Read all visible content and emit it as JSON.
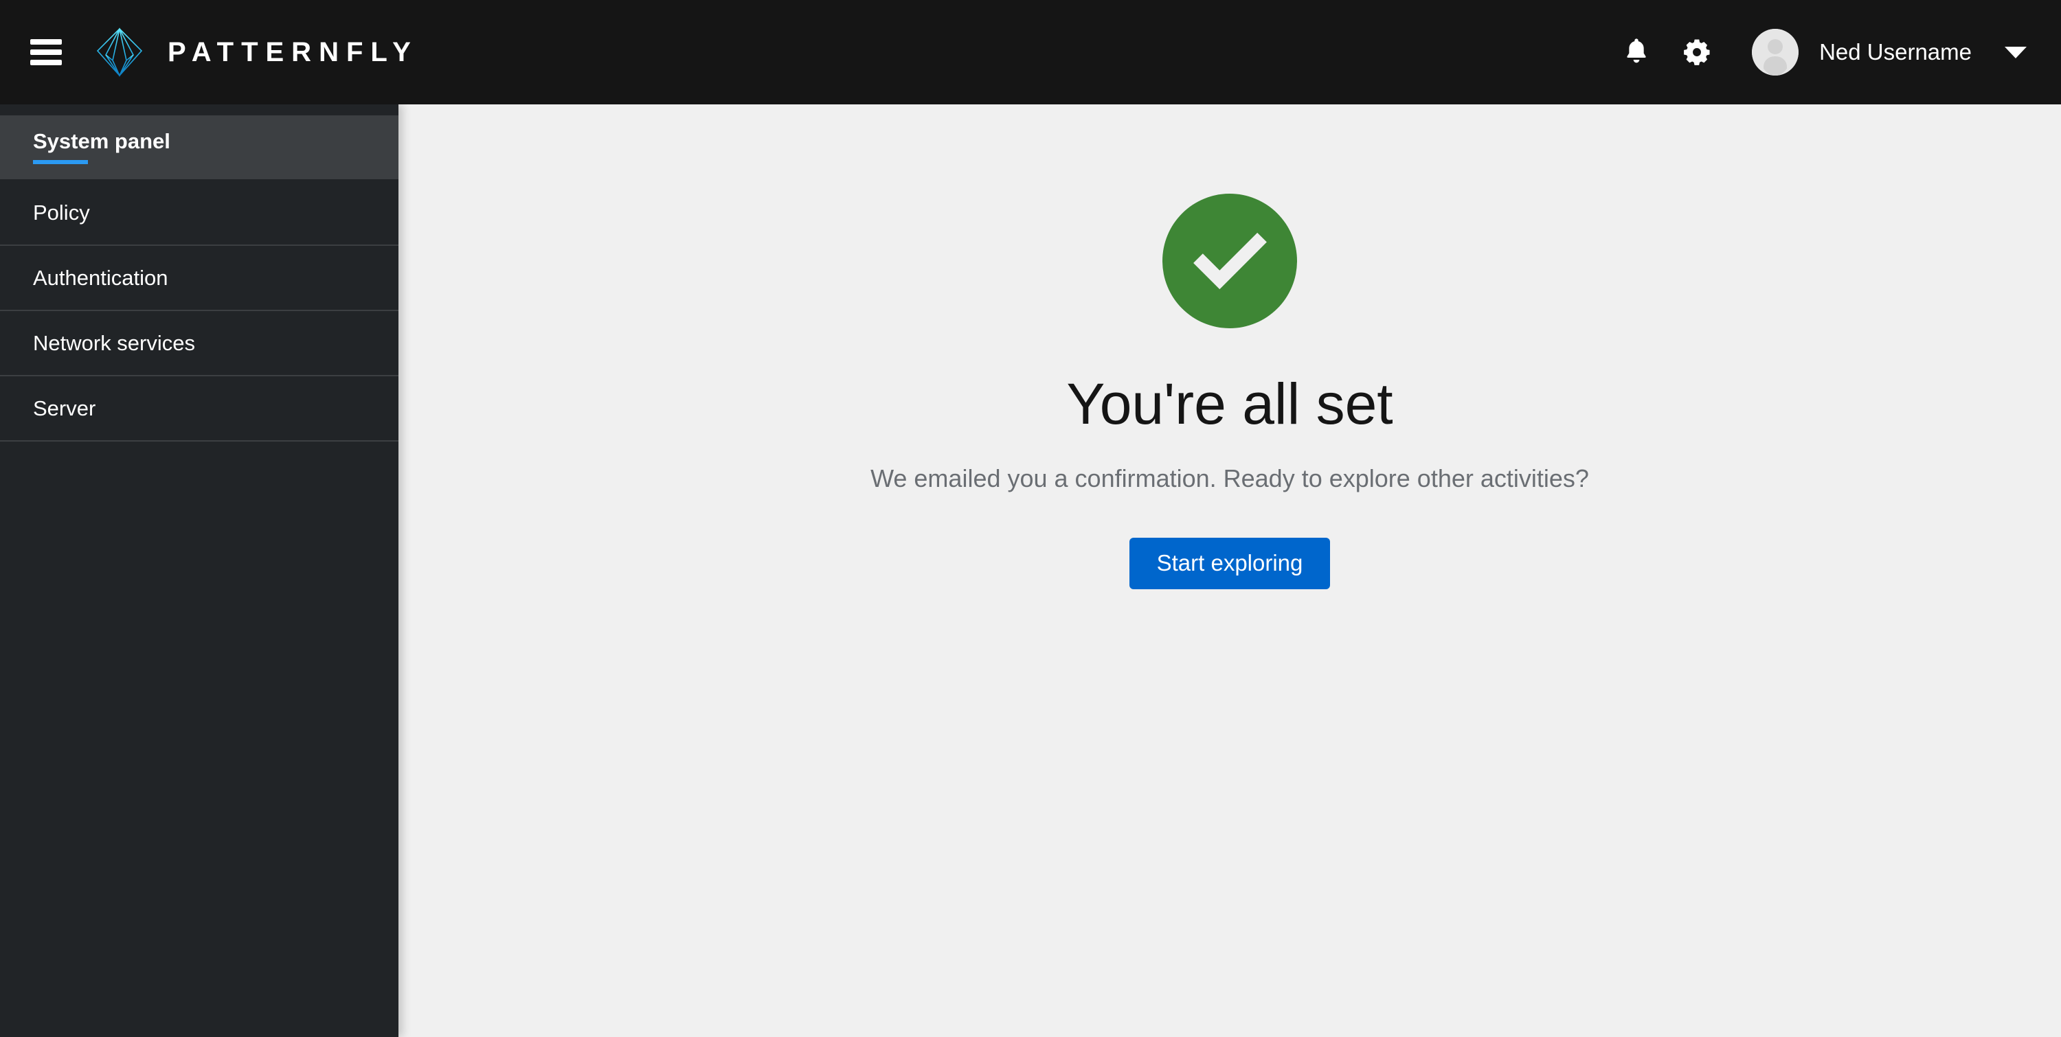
{
  "masthead": {
    "toggle_label": "Global navigation toggle",
    "brand_name": "PATTERNFLY",
    "brand_logo_name": "patternfly-logo",
    "notifications_label": "Notifications",
    "settings_label": "Settings",
    "user": {
      "name": "Ned Username",
      "avatar_label": "User avatar"
    }
  },
  "sidebar": {
    "items": [
      {
        "label": "System panel",
        "active": true
      },
      {
        "label": "Policy",
        "active": false
      },
      {
        "label": "Authentication",
        "active": false
      },
      {
        "label": "Network services",
        "active": false
      },
      {
        "label": "Server",
        "active": false
      }
    ]
  },
  "main": {
    "empty_state": {
      "icon": "success-check-circle-icon",
      "title": "You're all set",
      "body": "We emailed you a confirmation. Ready to explore other activities?",
      "primary_action": "Start exploring"
    }
  },
  "colors": {
    "masthead_bg": "#151515",
    "sidebar_bg": "#212427",
    "sidebar_active_bg": "#3c3f42",
    "accent_blue": "#2b9af3",
    "primary_button": "#0066cc",
    "success_green": "#3e8635",
    "content_bg": "#f0f0f0",
    "muted_text": "#6a6e73"
  }
}
